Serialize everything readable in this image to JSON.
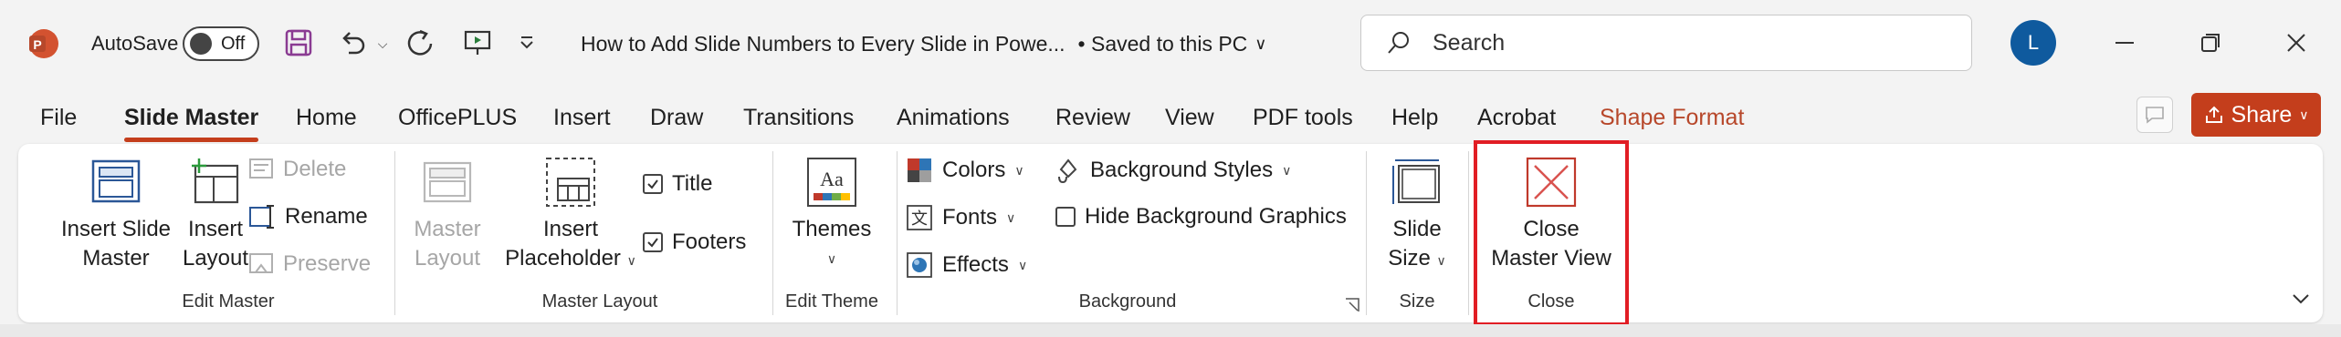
{
  "app": {
    "name": "PowerPoint",
    "icon": "powerpoint-app-icon",
    "brand_color": "#c43e1c"
  },
  "titlebar": {
    "autosave_label": "AutoSave",
    "autosave_state": "Off",
    "document_title": "How to Add Slide Numbers to Every Slide in Powe...",
    "save_status": "• Saved to this PC",
    "search_placeholder": "Search",
    "avatar_initial": "L"
  },
  "tabs": [
    {
      "label": "File"
    },
    {
      "label": "Slide Master",
      "active": true
    },
    {
      "label": "Home"
    },
    {
      "label": "OfficePLUS"
    },
    {
      "label": "Insert"
    },
    {
      "label": "Draw"
    },
    {
      "label": "Transitions"
    },
    {
      "label": "Animations"
    },
    {
      "label": "Review"
    },
    {
      "label": "View"
    },
    {
      "label": "PDF tools"
    },
    {
      "label": "Help"
    },
    {
      "label": "Acrobat"
    },
    {
      "label": "Shape Format",
      "contextual": true
    }
  ],
  "share_label": "Share",
  "ribbon": {
    "edit_master": {
      "label": "Edit Master",
      "insert_slide_master": [
        "Insert Slide",
        "Master"
      ],
      "insert_layout": [
        "Insert",
        "Layout"
      ],
      "delete": "Delete",
      "rename": "Rename",
      "preserve": "Preserve"
    },
    "master_layout": {
      "label": "Master Layout",
      "master_layout_btn": [
        "Master",
        "Layout"
      ],
      "insert_placeholder": [
        "Insert",
        "Placeholder"
      ],
      "title_cb": "Title",
      "footers_cb": "Footers"
    },
    "edit_theme": {
      "label": "Edit Theme",
      "themes": "Themes"
    },
    "background": {
      "label": "Background",
      "colors": "Colors",
      "fonts": "Fonts",
      "effects": "Effects",
      "background_styles": "Background Styles",
      "hide_bg_graphics": "Hide Background Graphics"
    },
    "size": {
      "label": "Size",
      "slide_size": [
        "Slide",
        "Size"
      ]
    },
    "close": {
      "label": "Close",
      "close_master_view": [
        "Close",
        "Master View"
      ],
      "highlight_color": "#e11d24"
    }
  }
}
